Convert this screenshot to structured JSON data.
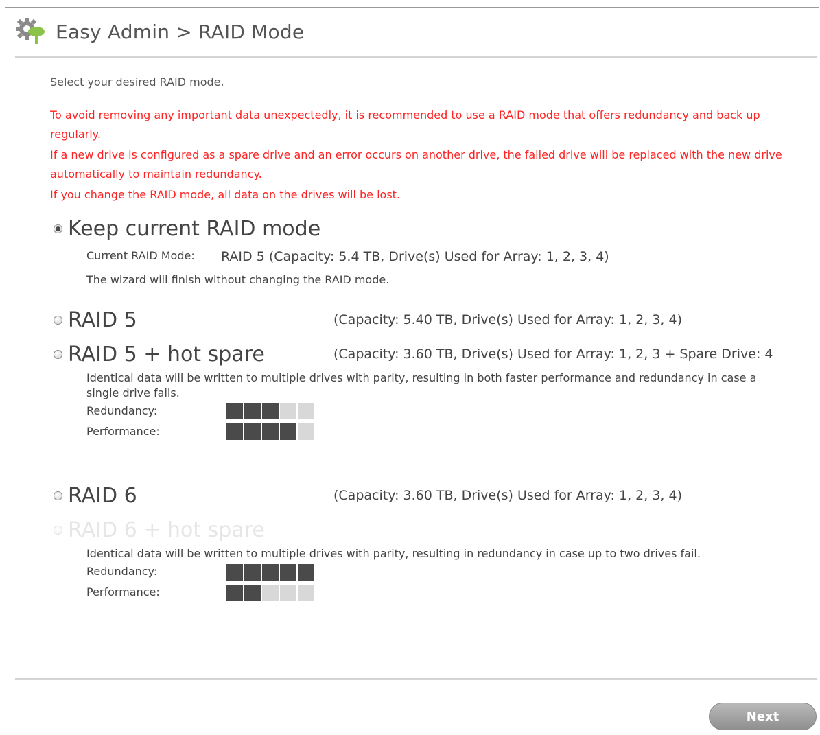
{
  "header": {
    "title": "Easy Admin > RAID Mode",
    "icon": "gear-tree-icon"
  },
  "intro": "Select your desired RAID mode.",
  "warnings": [
    "To avoid removing any important data unexpectedly, it is recommended to use a RAID mode that offers redundancy and back up regularly.",
    "If a new drive is configured as a spare drive and an error occurs on another drive, the failed drive will be replaced with the new drive automatically to maintain redundancy.",
    "If you change the RAID mode, all data on the drives will be lost."
  ],
  "keep": {
    "label": "Keep current RAID mode",
    "selected": true,
    "current_label": "Current RAID Mode:",
    "current_value": "RAID 5 (Capacity: 5.4 TB, Drive(s) Used for Array: 1, 2, 3, 4)",
    "note": "The wizard will finish without changing the RAID mode."
  },
  "options": {
    "raid5": {
      "label": "RAID 5",
      "capacity": "(Capacity: 5.40 TB, Drive(s) Used for Array: 1, 2, 3, 4)",
      "enabled": true
    },
    "raid5hs": {
      "label": "RAID 5 + hot spare",
      "capacity": "(Capacity: 3.60 TB, Drive(s) Used for Array: 1, 2, 3 + Spare Drive: 4",
      "enabled": true,
      "description": "Identical data will be written to multiple drives with parity, resulting in both faster performance and redundancy in case a single drive fails.",
      "redundancy_label": "Redundancy:",
      "performance_label": "Performance:",
      "redundancy_level": 3,
      "performance_level": 4,
      "scale_max": 5
    },
    "raid6": {
      "label": "RAID 6",
      "capacity": "(Capacity: 3.60 TB, Drive(s) Used for Array: 1, 2, 3, 4)",
      "enabled": true
    },
    "raid6hs": {
      "label": "RAID 6 + hot spare",
      "enabled": false,
      "description": "Identical data will be written to multiple drives with parity, resulting in redundancy in case up to two drives fail.",
      "redundancy_label": "Redundancy:",
      "performance_label": "Performance:",
      "redundancy_level": 5,
      "performance_level": 2,
      "scale_max": 5
    }
  },
  "next_label": "Next"
}
